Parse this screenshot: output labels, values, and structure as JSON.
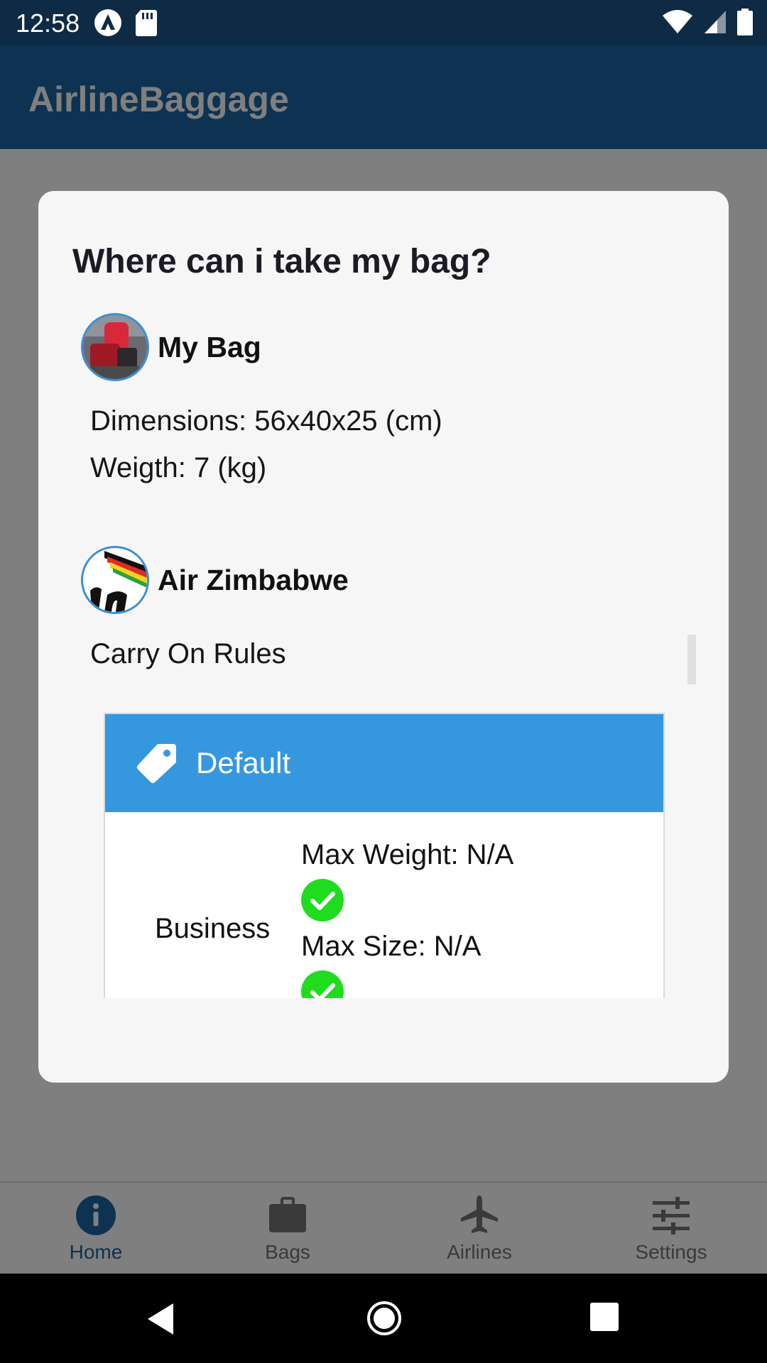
{
  "status_bar": {
    "time": "12:58"
  },
  "app_bar": {
    "title": "AirlineBaggage"
  },
  "dialog": {
    "title": "Where can i take my bag?",
    "bag": {
      "name": "My Bag",
      "dimensions": "Dimensions: 56x40x25 (cm)",
      "weight": "Weigth: 7 (kg)"
    },
    "airline": {
      "name": "Air Zimbabwe",
      "rules_heading": "Carry On Rules"
    },
    "rule_card": {
      "header_label": "Default",
      "class_label": "Business",
      "max_weight": "Max Weight: N/A",
      "max_size": "Max Size: N/A"
    }
  },
  "bottom_nav": {
    "items": [
      {
        "label": "Home"
      },
      {
        "label": "Bags"
      },
      {
        "label": "Airlines"
      },
      {
        "label": "Settings"
      }
    ]
  },
  "colors": {
    "app_bar": "#1c65a3",
    "accent_blue": "#3598de",
    "check_green": "#1fdc1f"
  }
}
